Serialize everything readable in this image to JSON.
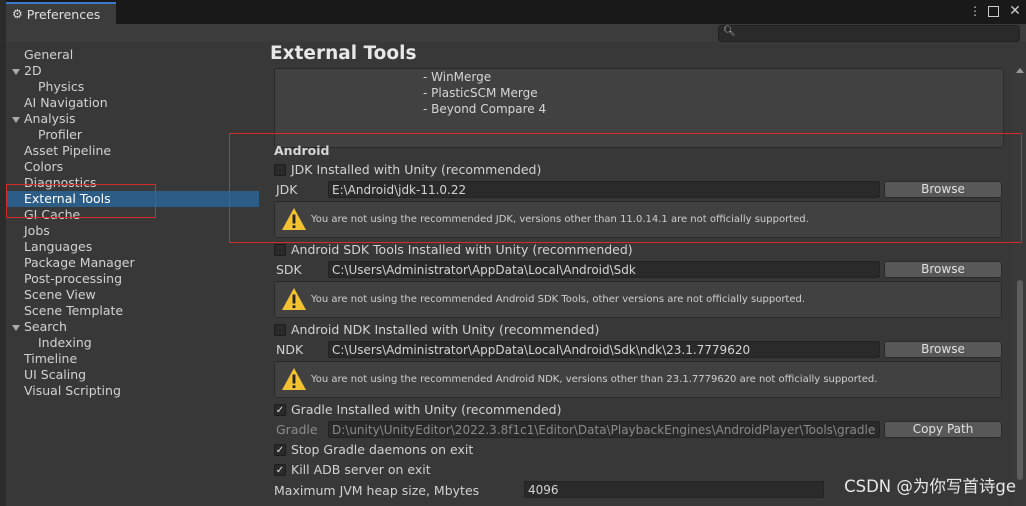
{
  "window": {
    "tab_title": "Preferences",
    "icons": [
      "gear-icon",
      "more-vertical-icon",
      "maximize-icon",
      "close-icon"
    ]
  },
  "search": {
    "placeholder": ""
  },
  "sidebar": {
    "items": [
      {
        "label": "General",
        "indent": 0,
        "arrow": false
      },
      {
        "label": "2D",
        "indent": 0,
        "arrow": true
      },
      {
        "label": "Physics",
        "indent": 1,
        "arrow": false
      },
      {
        "label": "AI Navigation",
        "indent": 0,
        "arrow": false
      },
      {
        "label": "Analysis",
        "indent": 0,
        "arrow": true
      },
      {
        "label": "Profiler",
        "indent": 1,
        "arrow": false
      },
      {
        "label": "Asset Pipeline",
        "indent": 0,
        "arrow": false
      },
      {
        "label": "Colors",
        "indent": 0,
        "arrow": false
      },
      {
        "label": "Diagnostics",
        "indent": 0,
        "arrow": false
      },
      {
        "label": "External Tools",
        "indent": 0,
        "arrow": false,
        "selected": true
      },
      {
        "label": "GI Cache",
        "indent": 0,
        "arrow": false
      },
      {
        "label": "Jobs",
        "indent": 0,
        "arrow": false
      },
      {
        "label": "Languages",
        "indent": 0,
        "arrow": false
      },
      {
        "label": "Package Manager",
        "indent": 0,
        "arrow": false
      },
      {
        "label": "Post-processing",
        "indent": 0,
        "arrow": false
      },
      {
        "label": "Scene View",
        "indent": 0,
        "arrow": false
      },
      {
        "label": "Scene Template",
        "indent": 0,
        "arrow": false
      },
      {
        "label": "Search",
        "indent": 0,
        "arrow": true
      },
      {
        "label": "Indexing",
        "indent": 1,
        "arrow": false
      },
      {
        "label": "Timeline",
        "indent": 0,
        "arrow": false
      },
      {
        "label": "UI Scaling",
        "indent": 0,
        "arrow": false
      },
      {
        "label": "Visual Scripting",
        "indent": 0,
        "arrow": false
      }
    ]
  },
  "main": {
    "title": "External Tools",
    "merge_tools": [
      "- WinMerge",
      "- PlasticSCM Merge",
      "- Beyond Compare 4"
    ],
    "android": {
      "section_title": "Android",
      "jdk": {
        "checkbox_label": "JDK Installed with Unity (recommended)",
        "checked": false,
        "field_label": "JDK",
        "path": "E:\\Android\\jdk-11.0.22",
        "button": "Browse",
        "warning": "You are not using the recommended JDK, versions other than 11.0.14.1 are not officially supported."
      },
      "sdk": {
        "checkbox_label": "Android SDK Tools Installed with Unity (recommended)",
        "checked": false,
        "field_label": "SDK",
        "path": "C:\\Users\\Administrator\\AppData\\Local\\Android\\Sdk",
        "button": "Browse",
        "warning": "You are not using the recommended Android SDK Tools, other versions are not officially supported."
      },
      "ndk": {
        "checkbox_label": "Android NDK Installed with Unity (recommended)",
        "checked": false,
        "field_label": "NDK",
        "path": "C:\\Users\\Administrator\\AppData\\Local\\Android\\Sdk\\ndk\\23.1.7779620",
        "button": "Browse",
        "warning": "You are not using the recommended Android NDK, versions other than 23.1.7779620 are not officially supported."
      },
      "gradle": {
        "checkbox_label": "Gradle Installed with Unity (recommended)",
        "checked": true,
        "field_label": "Gradle",
        "path": "D:\\unity\\UnityEditor\\2022.3.8f1c1\\Editor\\Data\\PlaybackEngines\\AndroidPlayer\\Tools\\gradle",
        "button": "Copy Path"
      },
      "stop_gradle": {
        "label": "Stop Gradle daemons on exit",
        "checked": true
      },
      "kill_adb": {
        "label": "Kill ADB server on exit",
        "checked": true
      },
      "jvm_heap": {
        "label": "Maximum JVM heap size, Mbytes",
        "value": "4096"
      }
    }
  },
  "watermark": "CSDN @为你写首诗ge",
  "colors": {
    "selection": "#2c5d87",
    "annotation_red": "#d42b2b",
    "warning_yellow": "#f2c230"
  }
}
